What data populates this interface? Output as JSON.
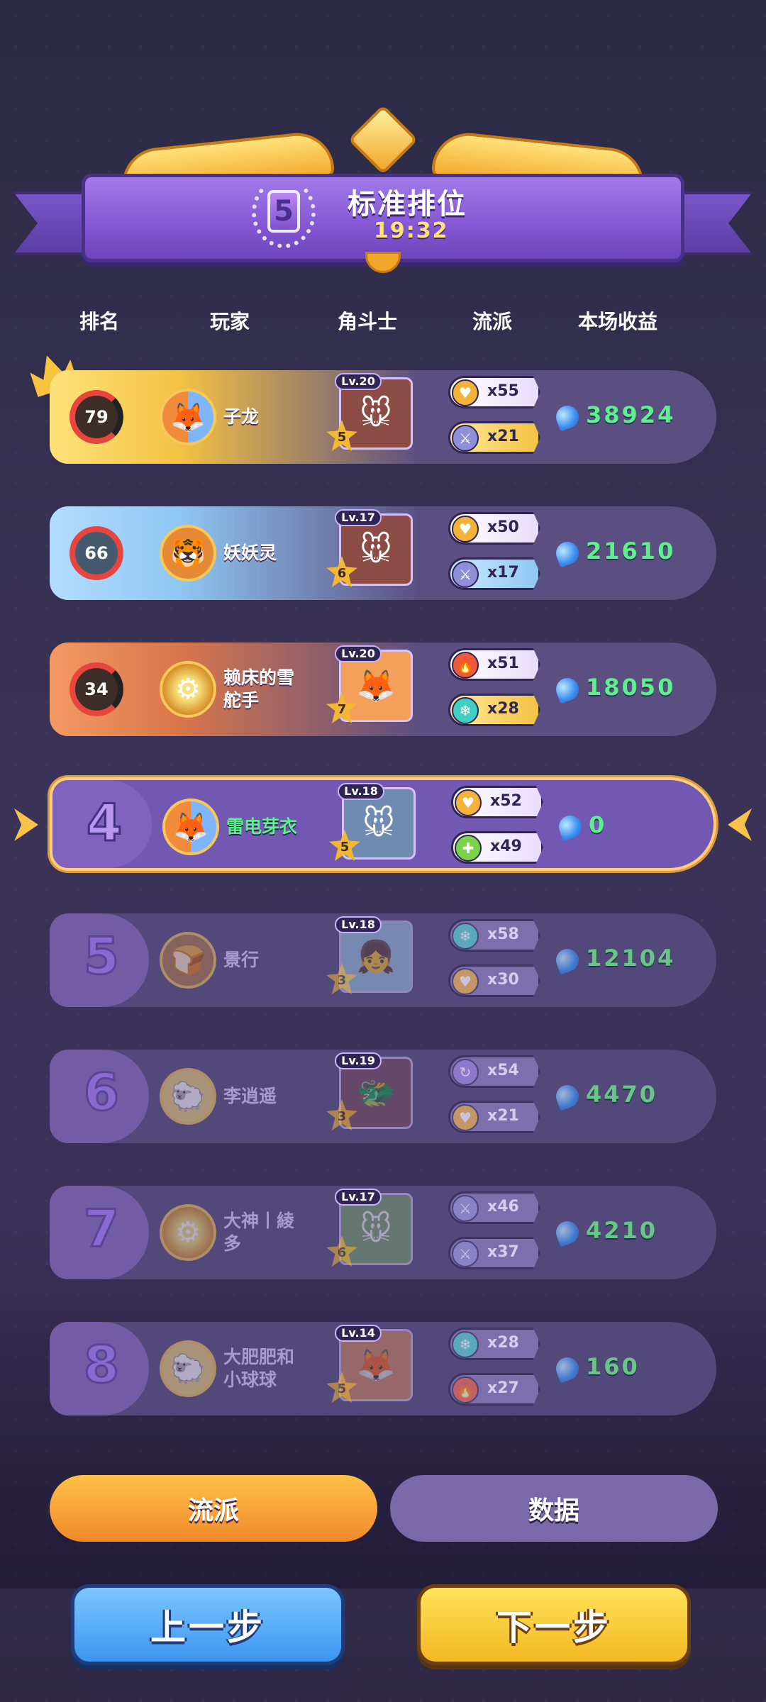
{
  "header": {
    "rank_badge": "5",
    "mode_title": "标准排位",
    "timer": "19:32"
  },
  "columns": {
    "rank": "排名",
    "player": "玩家",
    "fighter": "角斗士",
    "faction": "流派",
    "earnings": "本场收益"
  },
  "rows": [
    {
      "rank": "79",
      "name": "子龙",
      "level": "Lv.20",
      "stars": "5",
      "trait1_count": "x55",
      "trait2_count": "x21",
      "earnings": "38924"
    },
    {
      "rank": "66",
      "name": "妖妖灵",
      "level": "Lv.17",
      "stars": "6",
      "trait1_count": "x50",
      "trait2_count": "x17",
      "earnings": "21610"
    },
    {
      "rank": "34",
      "name": "赖床的雪舵手",
      "level": "Lv.20",
      "stars": "7",
      "trait1_count": "x51",
      "trait2_count": "x28",
      "earnings": "18050"
    },
    {
      "rank": "4",
      "name": "雷电芽衣",
      "level": "Lv.18",
      "stars": "5",
      "trait1_count": "x52",
      "trait2_count": "x49",
      "earnings": "0"
    },
    {
      "rank": "5",
      "name": "景行",
      "level": "Lv.18",
      "stars": "3",
      "trait1_count": "x58",
      "trait2_count": "x30",
      "earnings": "12104"
    },
    {
      "rank": "6",
      "name": "李逍遥",
      "level": "Lv.19",
      "stars": "3",
      "trait1_count": "x54",
      "trait2_count": "x21",
      "earnings": "4470"
    },
    {
      "rank": "7",
      "name": "大神丨綾多",
      "level": "Lv.17",
      "stars": "6",
      "trait1_count": "x46",
      "trait2_count": "x37",
      "earnings": "4210"
    },
    {
      "rank": "8",
      "name": "大肥肥和小球球",
      "level": "Lv.14",
      "stars": "5",
      "trait1_count": "x28",
      "trait2_count": "x27",
      "earnings": "160"
    }
  ],
  "tabs": {
    "faction": "流派",
    "data": "数据"
  },
  "buttons": {
    "prev": "上一步",
    "next": "下一步"
  },
  "icons": {
    "trait_icons": [
      "heart-icon",
      "sword-icon",
      "fire-icon",
      "snowflake-icon",
      "plus-icon",
      "orbit-icon"
    ],
    "currency": "gem-icon"
  },
  "colors": {
    "earnings_green": "#5ef08c",
    "highlight_border": "#ffce7a",
    "active_tab": "#f5a23a",
    "prev_button": "#4aa6f5",
    "next_button": "#f6c82e"
  }
}
